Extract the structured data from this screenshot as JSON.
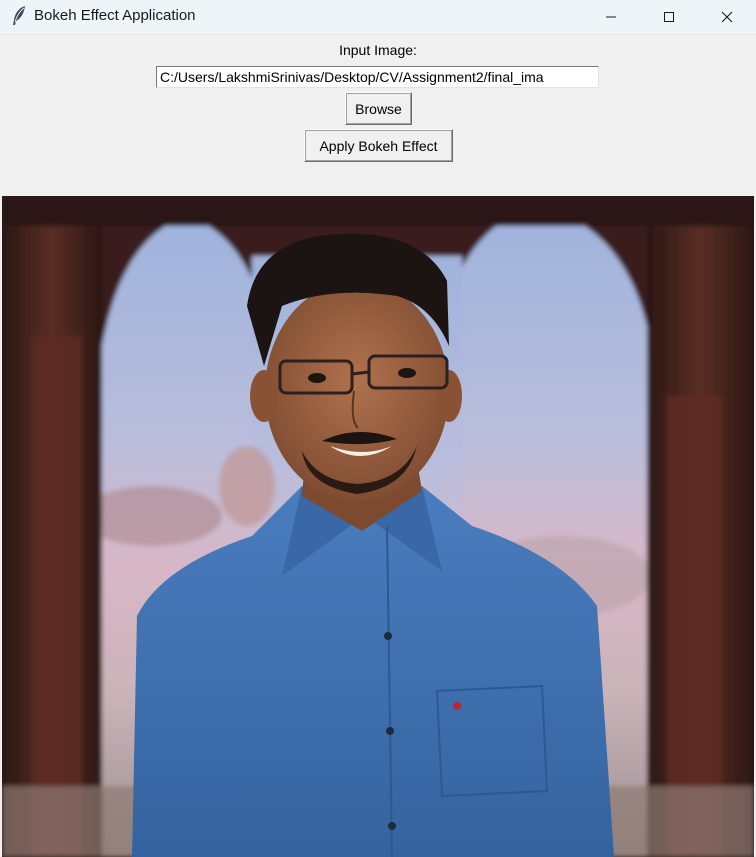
{
  "window": {
    "title": "Bokeh Effect Application",
    "icon": "feather-icon",
    "controls": {
      "minimize": "minimize-icon",
      "maximize": "maximize-icon",
      "close": "close-icon"
    }
  },
  "form": {
    "input_label": "Input Image:",
    "input_path": "C:/Users/LakshmiSrinivas/Desktop/CV/Assignment2/final_ima",
    "browse_label": "Browse",
    "apply_label": "Apply Bokeh Effect"
  },
  "colors": {
    "titlebar_bg": "#eff4f9",
    "window_bg": "#f0f0f0",
    "shirt_blue": "#3f6fae",
    "arch_dark": "#3a1e1a"
  }
}
